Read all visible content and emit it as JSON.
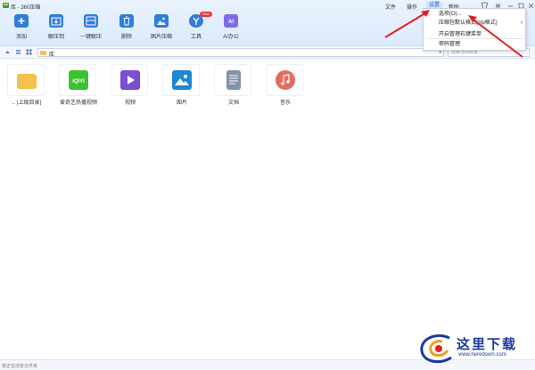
{
  "window": {
    "title": "库 - 360压缩"
  },
  "menu": {
    "file": "文件",
    "operate": "操作",
    "settings": "设置",
    "help": "帮助"
  },
  "toolbar": [
    {
      "label": "添加",
      "icon": "add-icon"
    },
    {
      "label": "解压到",
      "icon": "extract-to-icon"
    },
    {
      "label": "一键解压",
      "icon": "one-click-extract-icon"
    },
    {
      "label": "删除",
      "icon": "delete-icon"
    },
    {
      "label": "图片压缩",
      "icon": "image-compress-icon"
    },
    {
      "label": "工具",
      "icon": "tools-icon",
      "badge": "New"
    },
    {
      "label": "AI办公",
      "icon": "ai-office-icon"
    }
  ],
  "address": {
    "path": "库"
  },
  "search": {
    "placeholder": "搜索当前目录"
  },
  "files": [
    {
      "name": ".. (上级目录)",
      "icon": "folder-icon",
      "color": "#f2c14e"
    },
    {
      "name": "爱奇艺热播视频",
      "icon": "iqiyi-icon",
      "color": "#3cc332"
    },
    {
      "name": "视频",
      "icon": "video-icon",
      "color": "#7a4fd1"
    },
    {
      "name": "图片",
      "icon": "picture-icon",
      "color": "#1f86d6"
    },
    {
      "name": "文档",
      "icon": "document-icon",
      "color": "#7f93aa"
    },
    {
      "name": "音乐",
      "icon": "music-icon",
      "color": "#e86a5b"
    }
  ],
  "settings_menu": {
    "options": "选项(O)...",
    "default_format": "压缩包默认格式(zip格式)",
    "context_menu": "开启管理右键菜单",
    "password": "密码管理"
  },
  "status": {
    "text": "我正在浏览文件夹"
  },
  "watermark": {
    "title": "这里下载",
    "url": "www.heredown.com"
  },
  "colors": {
    "accent": "#2f7ed9",
    "arrow": "#e02020",
    "watermark": "#1a3aa0"
  }
}
